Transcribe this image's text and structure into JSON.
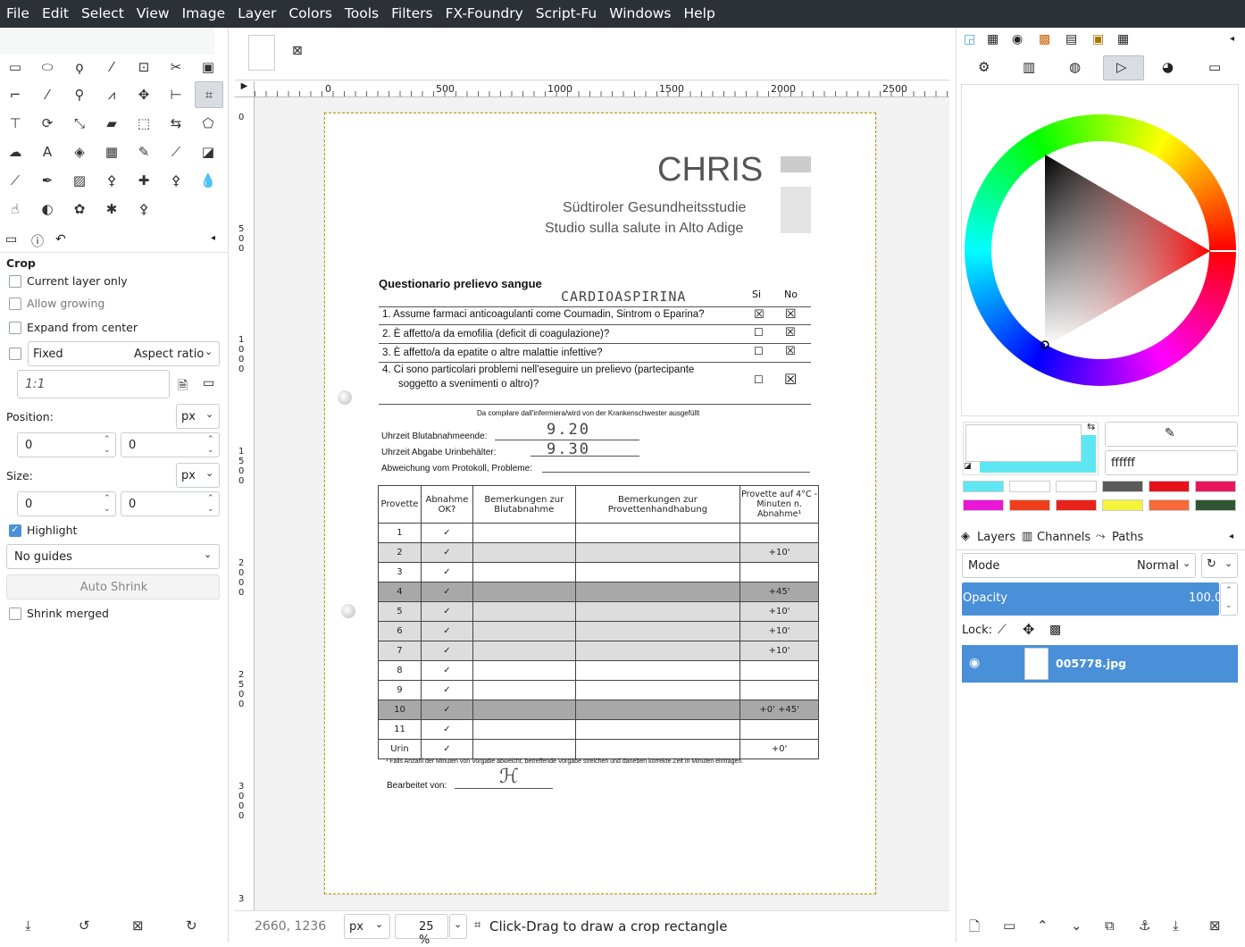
{
  "menu": [
    "File",
    "Edit",
    "Select",
    "View",
    "Image",
    "Layer",
    "Colors",
    "Tools",
    "Filters",
    "FX-Foundry",
    "Script-Fu",
    "Windows",
    "Help"
  ],
  "tool_options": {
    "title": "Crop",
    "current_layer_only": "Current layer only",
    "allow_growing": "Allow growing",
    "expand_from_center": "Expand from center",
    "fixed": "Fixed",
    "aspect_ratio": "Aspect ratio",
    "ratio_value": "1:1",
    "position_label": "Position:",
    "size_label": "Size:",
    "unit": "px",
    "pos_x": "0",
    "pos_y": "0",
    "size_w": "0",
    "size_h": "0",
    "highlight": "Highlight",
    "guides": "No guides",
    "auto_shrink": "Auto Shrink",
    "shrink_merged": "Shrink merged"
  },
  "ruler": {
    "h_ticks": [
      "0",
      "500",
      "1000",
      "1500",
      "2000",
      "2500"
    ],
    "v_ticks": [
      "0",
      "500",
      "1000",
      "1500",
      "2000",
      "2500",
      "3000",
      "3"
    ]
  },
  "document": {
    "title": "CHRIS",
    "subtitle1": "Südtiroler Gesundheitsstudie",
    "subtitle2": "Studio sulla salute in Alto Adige",
    "section": "Questionario prelievo sangue",
    "handwritten_note": "CARDIOASPIRINA",
    "col_si": "Si",
    "col_no": "No",
    "questions": [
      "1.  Assume farmaci anticoagulanti come Coumadin, Sintrom o Eparina?",
      "2.  È affetto/a da emofilia (deficit di coagulazione)?",
      "3.  È affetto/a da epatite o altre malattie infettive?",
      "4.  Ci sono particolari problemi nell'eseguire un prelievo (partecipante",
      "soggetto a svenimenti o altro)?"
    ],
    "nurse_note": "Da compilare dall'infermiera/wird von der Krankenschwester ausgefüllt",
    "blood_end": "Uhrzeit Blutabnahmeende:",
    "blood_end_val": "9.20",
    "urine": "Uhrzeit Abgabe Urinbehälter:",
    "urine_val": "9.30",
    "deviation": "Abweichung vom Protokoll, Probleme:",
    "table_headers": [
      "Provette",
      "Abnahme OK?",
      "Bemerkungen zur Blutabnahme",
      "Bemerkungen zur Provettenhandhabung",
      "Provette auf 4°C - Minuten n. Abnahme¹"
    ],
    "rows": [
      {
        "n": "1",
        "t": ""
      },
      {
        "n": "2",
        "t": "+10'"
      },
      {
        "n": "3",
        "t": ""
      },
      {
        "n": "4",
        "t": "+45'"
      },
      {
        "n": "5",
        "t": "+10'"
      },
      {
        "n": "6",
        "t": "+10'"
      },
      {
        "n": "7",
        "t": "+10'"
      },
      {
        "n": "8",
        "t": ""
      },
      {
        "n": "9",
        "t": ""
      },
      {
        "n": "10",
        "t": "+0'   +45'"
      },
      {
        "n": "11",
        "t": ""
      },
      {
        "n": "Urin",
        "t": "+0'"
      }
    ],
    "footnote": "¹ Falls Anzahl der Minuten von Vorgabe abweicht, betreffende Vorgabe streichen und daneben korrekte Zeit in Minuten eintragen.",
    "processed_by": "Bearbeitet von:"
  },
  "status": {
    "coords": "2660, 1236",
    "unit": "px",
    "zoom": "25 %",
    "message": "Click-Drag to draw a crop rectangle"
  },
  "colors": {
    "hex": "ffffff",
    "fg": "#ffffff",
    "bg": "#5ee7f2",
    "history": [
      "#5ee7f2",
      "#ffffff",
      "#ffffff",
      "#5a5a5a",
      "#e8121b",
      "#e8175d",
      "#e817d6",
      "#ef3f1a",
      "#e8221a",
      "#f4f43a",
      "#f76a3a",
      "#2f5630"
    ]
  },
  "layers": {
    "tabs": [
      "Layers",
      "Channels",
      "Paths"
    ],
    "mode_label": "Mode",
    "mode": "Normal",
    "opacity_label": "Opacity",
    "opacity": "100.0",
    "lock_label": "Lock:",
    "items": [
      {
        "name": "005778.jpg"
      }
    ]
  }
}
